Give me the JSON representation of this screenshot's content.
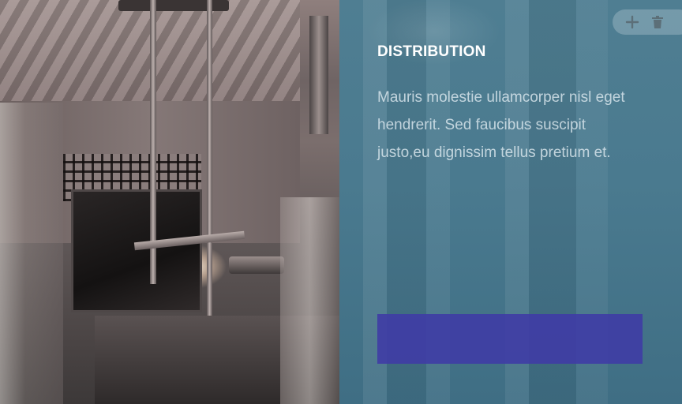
{
  "card": {
    "title": "DISTRIBUTION",
    "description": "Mauris molestie ullamcorper nisl eget hendrerit. Sed faucibus suscipit justo,eu dignissim tellus pretium et.",
    "button_label": ""
  },
  "toolbar": {
    "add_icon": "plus-icon",
    "delete_icon": "trash-icon"
  },
  "colors": {
    "panel_overlay": "#4a7a8f",
    "button": "#3f3ca5",
    "title_text": "#ffffff"
  },
  "image": {
    "subject": "laboratory-equipment-photo"
  }
}
